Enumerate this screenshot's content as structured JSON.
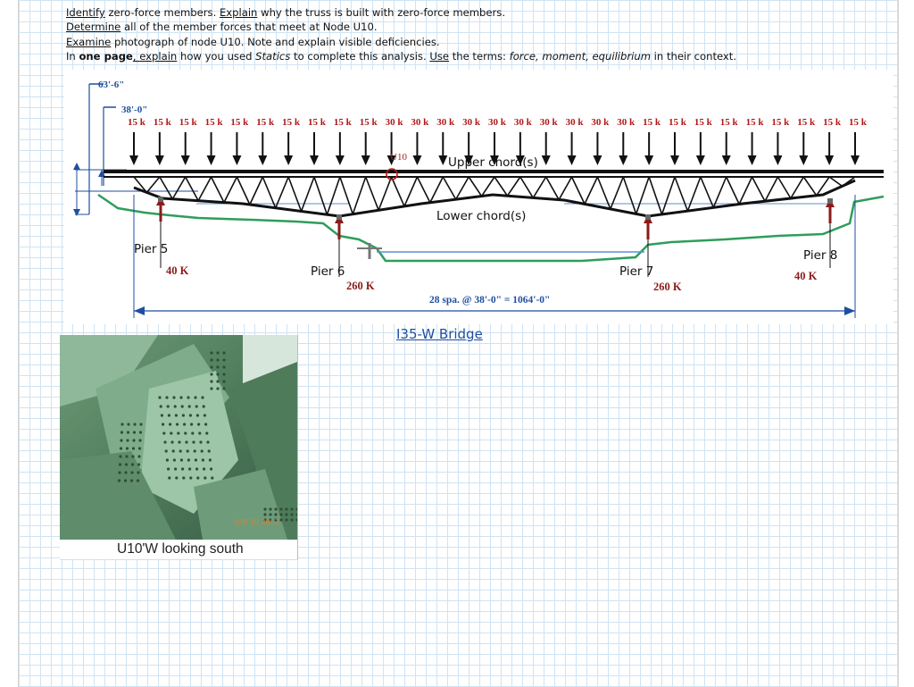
{
  "instructions": [
    {
      "verb": "Identify",
      "rest": " zero-force members. ",
      "verb2": "Explain",
      "rest2": " why the truss is built with zero-force members."
    },
    {
      "verb": "Determine",
      "rest": " all of the member forces that meet at Node U10."
    },
    {
      "verb": "Examine",
      "rest": " photograph of node U10. Note and explain visible deficiencies."
    },
    {
      "pre": "In ",
      "bold": "one page",
      "comma": ", ",
      "verb": "explain",
      "mid": " how you used ",
      "italic": "Statics",
      "mid2": " to complete this analysis. ",
      "verb2": "Use",
      "mid3": " the terms: ",
      "terms": "force, moment, equilibrium",
      "tail": " in their context."
    }
  ],
  "diagram": {
    "height_dim": "63'-6\"",
    "height_dim2": "38'-0\"",
    "loads": [
      "15 k",
      "15 k",
      "15 k",
      "15 k",
      "15 k",
      "15 k",
      "15 k",
      "15 k",
      "15 k",
      "15 k",
      "30 k",
      "30 k",
      "30 k",
      "30 k",
      "30 k",
      "30 k",
      "30 k",
      "30 k",
      "30 k",
      "30 k",
      "15 k",
      "15 k",
      "15 k",
      "15 k",
      "15 k",
      "15 k",
      "15 k",
      "15 k",
      "15 k"
    ],
    "node_label": "U10",
    "upper_chord": "Upper chord(s)",
    "lower_chord": "Lower chord(s)",
    "piers": [
      {
        "name": "Pier 5",
        "reaction": "40 K"
      },
      {
        "name": "Pier 6",
        "reaction": "260 K"
      },
      {
        "name": "Pier 7",
        "reaction": "260 K"
      },
      {
        "name": "Pier 8",
        "reaction": "40 K"
      }
    ],
    "span_dim": "28 spa. @ 38'-0\" = 1064'-0\""
  },
  "link_text": "I35-W Bridge",
  "photo": {
    "caption": "U10'W looking south",
    "date_stamp": "JUN 10 2003"
  },
  "colors": {
    "truss": "#111111",
    "ground": "#2e9e5a",
    "water": "#5b8fd6",
    "reaction": "#8b1a1a",
    "load_text": "#b01818"
  }
}
